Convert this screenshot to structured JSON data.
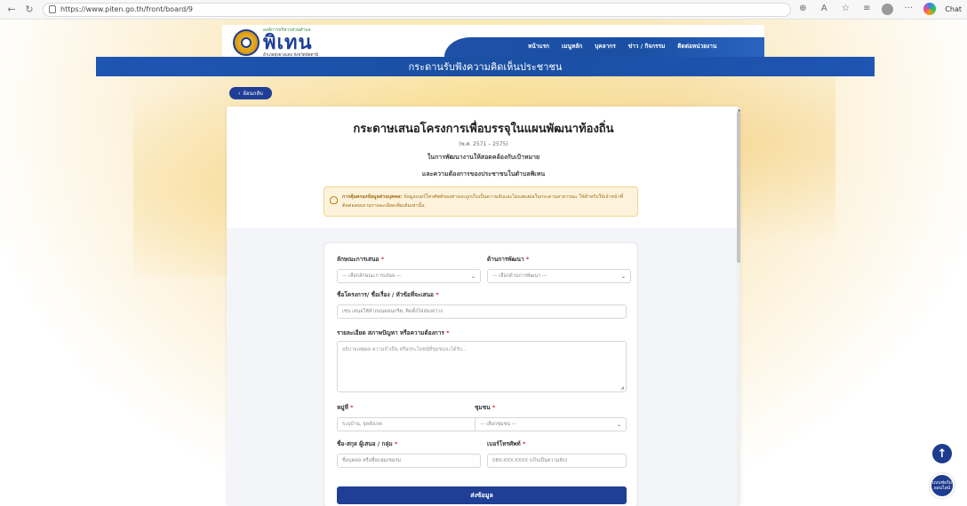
{
  "browser": {
    "url": "https://www.piten.go.th/front/board/9",
    "chat_label": "Chat"
  },
  "header": {
    "logo_top": "องค์การบริหารส่วนตำบล",
    "logo_main": "พิเทน",
    "logo_sub": "อำเภอทุ่งยางแดง จังหวัดปัตตานี",
    "menu": [
      "หน้าแรก",
      "เมนูหลัก",
      "บุคลากร",
      "ข่าว / กิจกรรม",
      "ติดต่อหน่วยงาน"
    ],
    "page_title": "กระดานรับฟังความคิดเห็นประชาชน"
  },
  "back_button": {
    "label": "ย้อนกลับ"
  },
  "intro": {
    "title": "กระดาษเสนอโครงการเพื่อบรรจุในแผนพัฒนาท้องถิ่น",
    "years": "(พ.ศ. 2571 – 2575)",
    "line1": "ในการพัฒนางานให้สอดคล้องกับเป้าหมาย",
    "line2": "และความต้องการของประชาชนในตำบลพิเทน",
    "notice_bold": "การคุ้มครองข้อมูลส่วนบุคคล:",
    "notice_text": "ข้อมูลเบอร์โทรศัพท์ของท่านจะถูกเก็บเป็นความลับและไม่แสดงผลในกระดานสาธารณะ ใช้สำหรับให้เจ้าหน้าที่ติดต่อสอบถามรายละเอียดเพิ่มเติมเท่านั้น"
  },
  "form": {
    "type_label": "ลักษณะการเสนอ",
    "type_value": "— เลือกลักษณะการเสนอ —",
    "dev_label": "ด้านการพัฒนา",
    "dev_value": "— เลือกด้านการพัฒนา —",
    "project_label": "ชื่อโครงการ/ ชื่อเรื่อง / หัวข้อที่จะเสนอ",
    "project_placeholder": "เช่น เสนอให้ทำถนนคอนกรีต, ติดตั้งไฟส่องสว่าง",
    "detail_label": "รายละเอียด สภาพปัญหา หรือความต้องการ",
    "detail_placeholder": "อธิบายเหตุผล ความจำเป็น หรือประโยชน์ที่ชุมชนจะได้รับ...",
    "village_label": "หมู่ที่",
    "village_placeholder": "ระบุบ้าน, จุดสังเกต",
    "community_label": "ชุมชน",
    "community_value": "— เลือกชุมชน —",
    "name_label": "ชื่อ-สกุล ผู้เสนอ / กลุ่ม",
    "name_placeholder": "ชื่อบุคคล หรือชื่อกลุ่ม/ชมรม",
    "phone_label": "เบอร์โทรศัพท์",
    "phone_placeholder": "08X-XXX-XXXX (เก็บเป็นความลับ)",
    "required_mark": "*",
    "submit_label": "ส่งข้อมูล"
  },
  "floating": {
    "help_label": "แบบฟอร์ม ออนไลน์"
  }
}
